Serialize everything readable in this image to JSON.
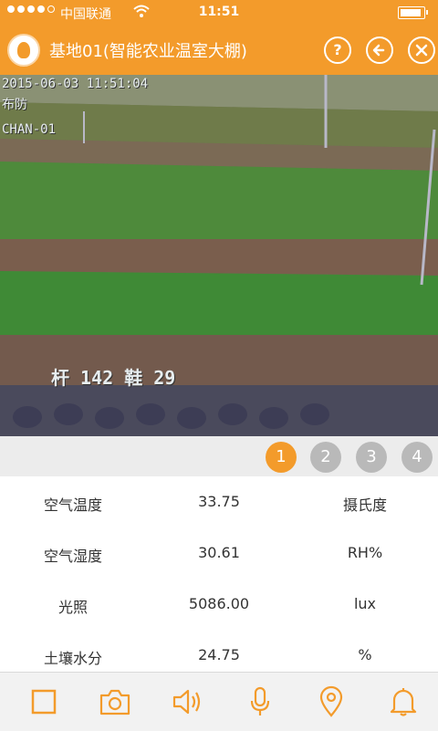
{
  "status_bar": {
    "carrier": "中国联通",
    "time": "11:51"
  },
  "header": {
    "title": "基地01(智能农业温室大棚)",
    "help_label": "?"
  },
  "video": {
    "timestamp": "2015-06-03 11:51:04",
    "location": "布防",
    "channel": "CHAN-01",
    "counts": "杆 142 鞋 29"
  },
  "pager": {
    "pages": [
      "1",
      "2",
      "3",
      "4"
    ],
    "active": "1"
  },
  "sensors": [
    {
      "name": "空气温度",
      "value": "33.75",
      "unit": "摄氏度"
    },
    {
      "name": "空气湿度",
      "value": "30.61",
      "unit": "RH%"
    },
    {
      "name": "光照",
      "value": "5086.00",
      "unit": "lux"
    },
    {
      "name": "土壤水分",
      "value": "24.75",
      "unit": "%"
    }
  ],
  "toolbar": {
    "icons": [
      "stop-icon",
      "camera-icon",
      "speaker-icon",
      "microphone-icon",
      "location-icon",
      "bell-icon"
    ]
  },
  "colors": {
    "accent": "#f39b2b",
    "inactive_page": "#b9b9b9"
  }
}
